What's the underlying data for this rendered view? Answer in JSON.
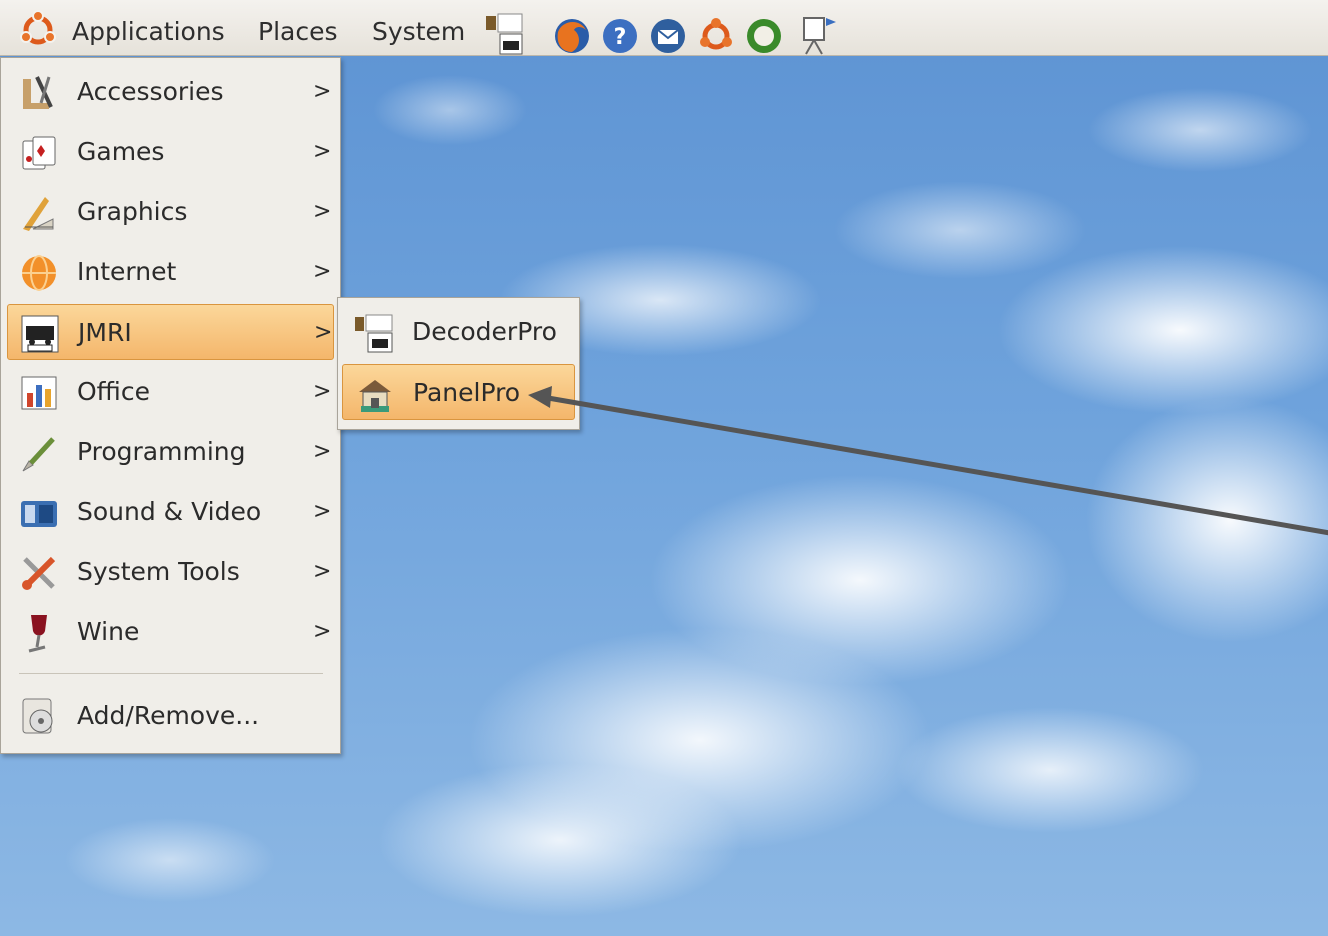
{
  "panel": {
    "menus": {
      "applications": "Applications",
      "places": "Places",
      "system": "System"
    },
    "launchers": [
      "decoderpro-icon",
      "firefox-icon",
      "help-icon",
      "thunderbird-icon",
      "ubuntu-icon",
      "update-icon",
      "presentation-icon"
    ]
  },
  "applications_menu": {
    "items": [
      {
        "label": "Accessories",
        "icon": "accessories-icon",
        "submenu": true
      },
      {
        "label": "Games",
        "icon": "games-icon",
        "submenu": true
      },
      {
        "label": "Graphics",
        "icon": "graphics-icon",
        "submenu": true
      },
      {
        "label": "Internet",
        "icon": "internet-icon",
        "submenu": true
      },
      {
        "label": "JMRI",
        "icon": "jmri-icon",
        "submenu": true,
        "active": true
      },
      {
        "label": "Office",
        "icon": "office-icon",
        "submenu": true
      },
      {
        "label": "Programming",
        "icon": "programming-icon",
        "submenu": true
      },
      {
        "label": "Sound & Video",
        "icon": "sound-video-icon",
        "submenu": true
      },
      {
        "label": "System Tools",
        "icon": "system-tools-icon",
        "submenu": true
      },
      {
        "label": "Wine",
        "icon": "wine-icon",
        "submenu": true
      }
    ],
    "footer_item": {
      "label": "Add/Remove...",
      "icon": "add-remove-icon"
    },
    "submenu_arrow": ">"
  },
  "jmri_submenu": {
    "items": [
      {
        "label": "DecoderPro",
        "icon": "decoderpro-icon"
      },
      {
        "label": "PanelPro",
        "icon": "panelpro-icon",
        "active": true
      }
    ]
  },
  "colors": {
    "menu_background": "#f0eee9",
    "highlight": "#f4b66b",
    "panel_background": "#ebe8e1",
    "annotation_arrow": "#555555"
  }
}
